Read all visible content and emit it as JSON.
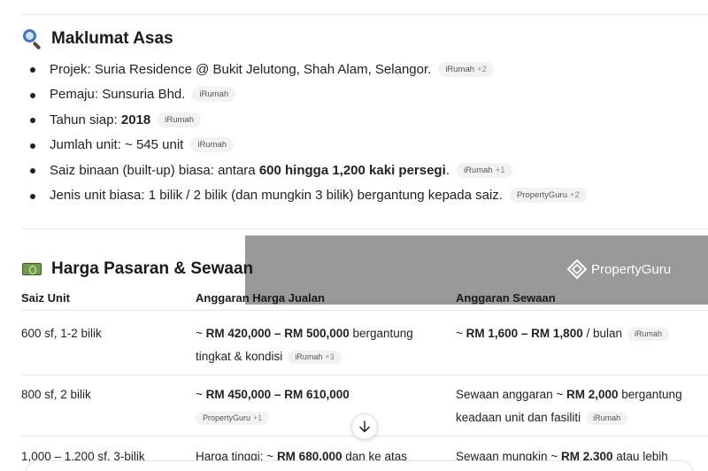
{
  "section1": {
    "title": "Maklumat Asas",
    "icon": "magnifying-glass-icon",
    "items": [
      {
        "text": "Projek: Suria Residence @ Bukit Jelutong, Shah Alam, Selangor.",
        "bold": "",
        "tail": "",
        "source": "iRumah",
        "extra": "+2"
      },
      {
        "text": "Pemaju: Sunsuria Bhd.",
        "bold": "",
        "tail": "",
        "source": "iRumah",
        "extra": ""
      },
      {
        "text": "Tahun siap: ",
        "bold": "2018",
        "tail": "",
        "source": "iRumah",
        "extra": ""
      },
      {
        "text": "Jumlah unit: ~ 545 unit",
        "bold": "",
        "tail": "",
        "source": "iRumah",
        "extra": ""
      },
      {
        "text": "Saiz binaan (built-up) biasa: antara ",
        "bold": "600 hingga 1,200 kaki persegi",
        "tail": ".",
        "source": "iRumah",
        "extra": "+1"
      },
      {
        "text": "Jenis unit biasa: 1 bilik / 2 bilik (dan mungkin 3 bilik) bergantung kepada saiz.",
        "bold": "",
        "tail": "",
        "source": "PropertyGuru",
        "extra": "+2"
      }
    ]
  },
  "section2": {
    "title": "Harga Pasaran & Sewaan",
    "icon": "money-bill-icon"
  },
  "watermark": {
    "text": "PropertyGuru"
  },
  "table": {
    "headers": [
      "Saiz Unit",
      "Anggaran Harga Jualan",
      "Anggaran Sewaan"
    ],
    "rows": [
      {
        "size": "600 sf, 1-2 bilik",
        "price_pre": "~ ",
        "price_bold": "RM 420,000 – RM 500,000",
        "price_post": " bergantung",
        "price_line2": "tingkat & kondisi",
        "price_source": "iRumah",
        "price_extra": "+3",
        "rent_pre": "~ ",
        "rent_bold": "RM 1,600 – RM 1,800",
        "rent_post": " / bulan",
        "rent_source": "iRumah",
        "rent_extra": ""
      },
      {
        "size": "800 sf, 2 bilik",
        "price_pre": "~ ",
        "price_bold": "RM 450,000 – RM 610,000",
        "price_post": "",
        "price_line2": "",
        "price_source": "PropertyGuru",
        "price_extra": "+1",
        "rent_pre": "Sewaan anggaran ~ ",
        "rent_bold": "RM 2,000",
        "rent_post": " bergantung",
        "rent_line2": "keadaan unit dan fasiliti",
        "rent_source": "iRumah",
        "rent_extra": ""
      },
      {
        "size": "1,000 – 1,200 sf, 3-bilik",
        "price_pre": "Harga tinggi: ~ ",
        "price_bold": "RM 680,000",
        "price_post": " dan ke atas",
        "rent_pre": "Sewaan mungkin ~ ",
        "rent_bold": "RM 2,300",
        "rent_post": " atau lebih"
      }
    ]
  },
  "scroll_button": {
    "icon": "arrow-down-icon"
  }
}
